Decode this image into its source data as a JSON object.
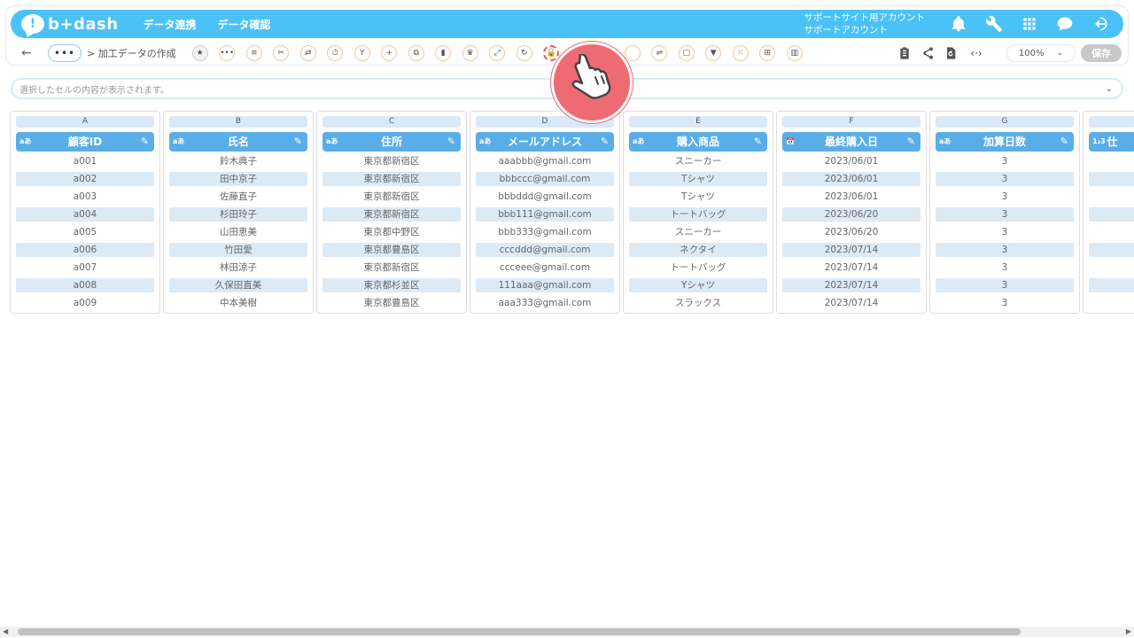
{
  "app": {
    "logo_text": "b+dash",
    "nav": [
      "データ連携",
      "データ確認"
    ],
    "account_line1": "サポートサイト用アカウント",
    "account_line2": "サポートアカウント"
  },
  "toolbar": {
    "back_icon": "←",
    "more_label": "•••",
    "breadcrumb": "> 加工データの作成",
    "zoom": "100%",
    "save_label": "保存"
  },
  "cell_preview": {
    "placeholder": "選択したセルの内容が表示されます。"
  },
  "columns": [
    {
      "letter": "A",
      "name": "顧客ID",
      "type": "aあ",
      "cells": [
        "a001",
        "a002",
        "a003",
        "a004",
        "a005",
        "a006",
        "a007",
        "a008",
        "a009"
      ]
    },
    {
      "letter": "B",
      "name": "氏名",
      "type": "aあ",
      "cells": [
        "鈴木典子",
        "田中京子",
        "佐藤直子",
        "杉田玲子",
        "山田恵美",
        "竹田愛",
        "林田涼子",
        "久保田直美",
        "中本美樹"
      ]
    },
    {
      "letter": "C",
      "name": "住所",
      "type": "aあ",
      "cells": [
        "東京都新宿区",
        "東京都新宿区",
        "東京都新宿区",
        "東京都新宿区",
        "東京都中野区",
        "東京都豊島区",
        "東京都新宿区",
        "東京都杉並区",
        "東京都豊島区"
      ]
    },
    {
      "letter": "D",
      "name": "メールアドレス",
      "type": "aあ",
      "cells": [
        "aaabbb@gmail.com",
        "bbbccc@gmail.com",
        "bbbddd@gmail.com",
        "bbb111@gmail.com",
        "bbb333@gmail.com",
        "cccddd@gmail.com",
        "ccceee@gmail.com",
        "111aaa@gmail.com",
        "aaa333@gmail.com"
      ]
    },
    {
      "letter": "E",
      "name": "購入商品",
      "type": "aあ",
      "cells": [
        "スニーカー",
        "Tシャツ",
        "Tシャツ",
        "トートバッグ",
        "スニーカー",
        "ネクタイ",
        "トートバッグ",
        "Yシャツ",
        "スラックス"
      ]
    },
    {
      "letter": "F",
      "name": "最終購入日",
      "type": "📅",
      "cells": [
        "2023/06/01",
        "2023/06/01",
        "2023/06/01",
        "2023/06/20",
        "2023/06/20",
        "2023/07/14",
        "2023/07/14",
        "2023/07/14",
        "2023/07/14"
      ]
    },
    {
      "letter": "G",
      "name": "加算日数",
      "type": "aあ",
      "cells": [
        "3",
        "3",
        "3",
        "3",
        "3",
        "3",
        "3",
        "3",
        "3"
      ]
    },
    {
      "letter": "",
      "name": "仕",
      "type": "1₂3",
      "cells": [
        "",
        "",
        "",
        "",
        "",
        "",
        "",
        "",
        ""
      ]
    }
  ],
  "colors": {
    "topbar": "#4ac2f7",
    "header": "#5aaee8",
    "alt_row": "#dceaf6",
    "cursor": "#ef6b73"
  }
}
